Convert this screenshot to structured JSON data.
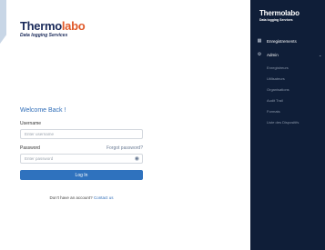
{
  "brand": {
    "name_part1": "Thermo",
    "name_part2": "labo",
    "tagline": "Data logging Services"
  },
  "login": {
    "welcome": "Welcome Back !",
    "username_label": "Username",
    "username_placeholder": "Enter username",
    "password_label": "Password",
    "forgot_password": "Forgot password?",
    "password_placeholder": "Enter password",
    "login_button": "Log In",
    "no_account_text": "Don't have an account?",
    "contact_link": "Contact us"
  },
  "sidebar": {
    "brand_part1": "Thermo",
    "brand_part2": "labo",
    "tagline": "Data logging Services",
    "items": [
      {
        "label": "Enregistrements",
        "icon": "grid-icon"
      },
      {
        "label": "Admin",
        "icon": "gear-icon"
      }
    ],
    "admin_submenu": [
      "Enregistreurs",
      "Utilisateurs",
      "Organisations",
      "Audit Trail",
      "Formats",
      "Liste des Dispositifs"
    ]
  },
  "colors": {
    "sidebar_bg": "#0f1e38",
    "primary": "#2f72be",
    "brand_accent": "#e05a2a"
  }
}
